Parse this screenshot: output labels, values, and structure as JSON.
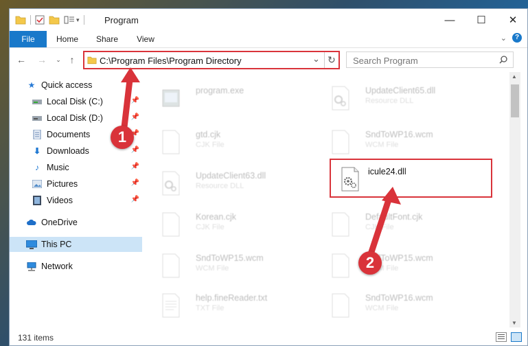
{
  "window": {
    "title": "Program",
    "minimize_glyph": "—",
    "maximize_glyph": "☐",
    "close_glyph": "✕"
  },
  "ribbon": {
    "tabs": [
      "File",
      "Home",
      "Share",
      "View"
    ]
  },
  "address": {
    "path": "C:\\Program Files\\Program Directory",
    "refresh_glyph": "↻",
    "dropdown_glyph": "⌄"
  },
  "search": {
    "placeholder": "Search Program",
    "icon": "search-icon"
  },
  "sidebar": {
    "items": [
      {
        "label": "Quick access",
        "icon": "star-icon",
        "pinned": false
      },
      {
        "label": "Local Disk (C:)",
        "icon": "drive-icon",
        "pinned": true
      },
      {
        "label": "Local Disk (D:)",
        "icon": "drive-icon",
        "pinned": true
      },
      {
        "label": "Documents",
        "icon": "documents-icon",
        "pinned": true
      },
      {
        "label": "Downloads",
        "icon": "downloads-icon",
        "pinned": true
      },
      {
        "label": "Music",
        "icon": "music-icon",
        "pinned": true
      },
      {
        "label": "Pictures",
        "icon": "pictures-icon",
        "pinned": true
      },
      {
        "label": "Videos",
        "icon": "videos-icon",
        "pinned": true
      },
      {
        "label": "OneDrive",
        "icon": "cloud-icon",
        "pinned": false
      },
      {
        "label": "This PC",
        "icon": "computer-icon",
        "pinned": false,
        "selected": true
      },
      {
        "label": "Network",
        "icon": "network-icon",
        "pinned": false
      }
    ]
  },
  "files": [
    {
      "name": "program.exe",
      "type": ""
    },
    {
      "name": "UpdateClient65.dll",
      "type": "Resource DLL"
    },
    {
      "name": "gtd.cjk",
      "type": "CJK File"
    },
    {
      "name": "SndToWP16.wcm",
      "type": "WCM File"
    },
    {
      "name": "UpdateClient63.dll",
      "type": "Resource DLL"
    },
    {
      "name": "icule24.dll",
      "type": "",
      "highlighted": true
    },
    {
      "name": "Korean.cjk",
      "type": "CJK File"
    },
    {
      "name": "DefaultFont.cjk",
      "type": "CJK File"
    },
    {
      "name": "SndToWP15.wcm",
      "type": "WCM File"
    },
    {
      "name": "SndToWP15.wcm",
      "type": "WCM File"
    },
    {
      "name": "help.fineReader.txt",
      "type": "TXT File"
    },
    {
      "name": "SndToWP16.wcm",
      "type": "WCM File"
    }
  ],
  "status": {
    "item_count": "131 items"
  },
  "callouts": {
    "one": "1",
    "two": "2"
  },
  "colors": {
    "accent": "#1979ca",
    "highlight": "#d9333a",
    "selected": "#cce4f7"
  }
}
